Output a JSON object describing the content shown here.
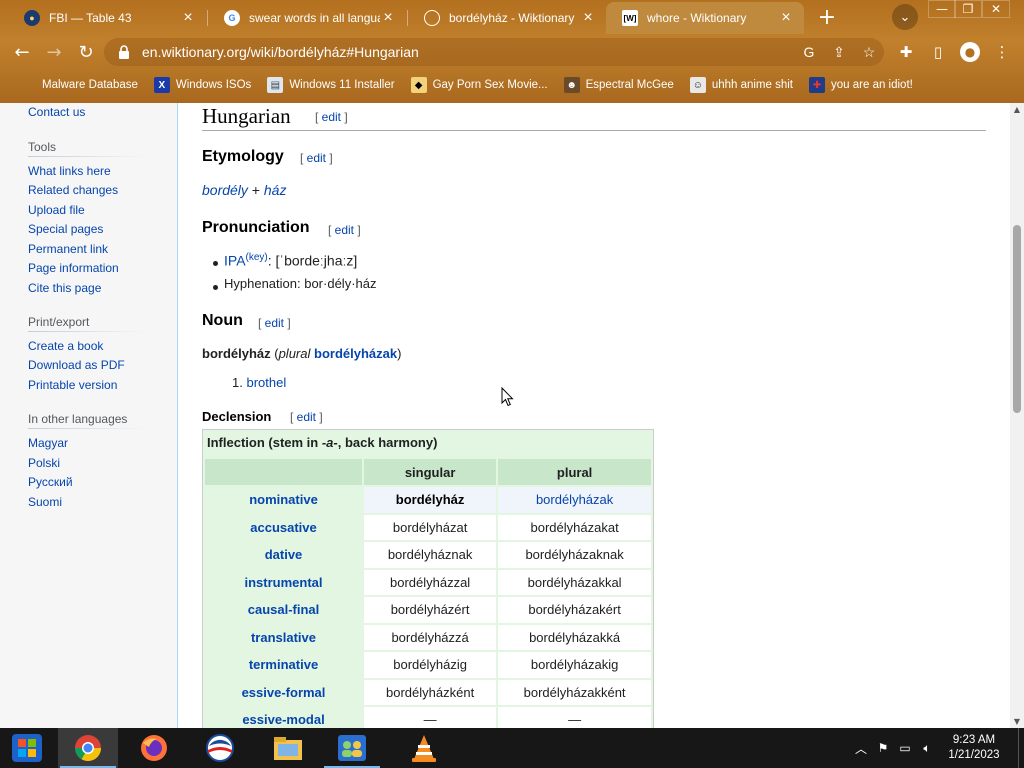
{
  "browser": {
    "tabs": [
      {
        "title": "FBI — Table 43",
        "favicon": "fbi-seal-icon",
        "active": false
      },
      {
        "title": "swear words in all languag",
        "favicon": "google-icon",
        "active": false
      },
      {
        "title": "bordélyház - Wiktionary",
        "favicon": "globe-icon",
        "active": false
      },
      {
        "title": "whore - Wiktionary",
        "favicon": "wiktionary-icon",
        "active": true
      }
    ],
    "new_tab_label": "+",
    "url": "en.wiktionary.org/wiki/bordélyház#Hungarian",
    "bookmarks": [
      {
        "label": "Malware Database",
        "icon": "folder-icon"
      },
      {
        "label": "Windows ISOs",
        "icon": "x-logo-icon"
      },
      {
        "label": "Windows 11 Installer",
        "icon": "installer-icon"
      },
      {
        "label": "Gay Porn Sex Movie...",
        "icon": "tux-icon"
      },
      {
        "label": "Espectral McGee",
        "icon": "avatar-icon"
      },
      {
        "label": "uhhh anime shit",
        "icon": "anime-icon"
      },
      {
        "label": "you are an idiot!",
        "icon": "flag-icon"
      }
    ]
  },
  "sidebar": {
    "top_link": "Contact us",
    "tools_heading": "Tools",
    "tools": [
      "What links here",
      "Related changes",
      "Upload file",
      "Special pages",
      "Permanent link",
      "Page information",
      "Cite this page"
    ],
    "print_heading": "Print/export",
    "print": [
      "Create a book",
      "Download as PDF",
      "Printable version"
    ],
    "languages_heading": "In other languages",
    "languages": [
      "Magyar",
      "Polski",
      "Русский",
      "Suomi"
    ]
  },
  "article": {
    "language_heading": "Hungarian",
    "edit_label": "edit",
    "etymology_heading": "Etymology",
    "etymology_part1": "bordély",
    "etymology_plus": " + ",
    "etymology_part2": "ház",
    "pronunciation_heading": "Pronunciation",
    "ipa_label": "IPA",
    "ipa_key": "(key)",
    "ipa_value": ": [ˈbordeːjhaːz]",
    "hyphenation": "Hyphenation: bor·dély·ház",
    "noun_heading": "Noun",
    "headword": "bordélyház",
    "plural_open": " (",
    "plural_label": "plural",
    "plural_form": "bordélyházak",
    "plural_close": ")",
    "sense_number": "1.",
    "sense": "brothel",
    "declension_heading": "Declension",
    "inflection_title_pre": "Inflection (stem in ",
    "inflection_stem": "-a-",
    "inflection_title_post": ", back harmony)",
    "col_singular": "singular",
    "col_plural": "plural",
    "rows": [
      {
        "case": "nominative",
        "singular": "bordélyház",
        "plural": "bordélyházak"
      },
      {
        "case": "accusative",
        "singular": "bordélyházat",
        "plural": "bordélyházakat"
      },
      {
        "case": "dative",
        "singular": "bordélyháznak",
        "plural": "bordélyházaknak"
      },
      {
        "case": "instrumental",
        "singular": "bordélyházzal",
        "plural": "bordélyházakkal"
      },
      {
        "case": "causal-final",
        "singular": "bordélyházért",
        "plural": "bordélyházakért"
      },
      {
        "case": "translative",
        "singular": "bordélyházzá",
        "plural": "bordélyházakká"
      },
      {
        "case": "terminative",
        "singular": "bordélyházig",
        "plural": "bordélyházakig"
      },
      {
        "case": "essive-formal",
        "singular": "bordélyházként",
        "plural": "bordélyházakként"
      },
      {
        "case": "essive-modal",
        "singular": "—",
        "plural": "—"
      }
    ]
  },
  "taskbar": {
    "apps": [
      "start-icon",
      "chrome-icon",
      "firefox-icon",
      "obama-logo-icon",
      "file-explorer-icon",
      "network-people-icon",
      "vlc-icon"
    ],
    "time": "9:23 AM",
    "date": "1/21/2023"
  },
  "colors": {
    "link": "#0645ad",
    "table_header_green": "#c8e6c9",
    "table_bg_green": "#e2f6e2",
    "chrome_theme": "#b3701f",
    "taskbar": "#171717"
  }
}
